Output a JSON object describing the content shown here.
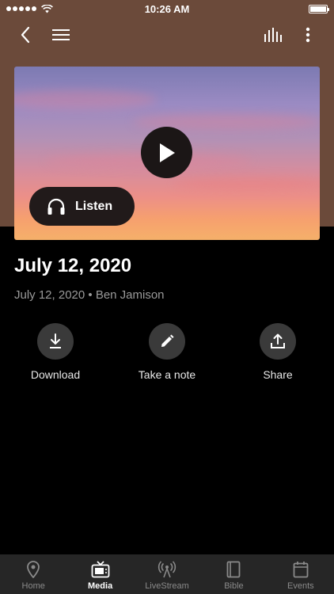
{
  "status": {
    "time": "10:26 AM"
  },
  "nav": {
    "back_icon": "chevron-left-icon",
    "menu_icon": "hamburger-menu-icon",
    "equalizer_icon": "equalizer-icon",
    "more_icon": "more-vertical-icon"
  },
  "media": {
    "listen_label": "Listen",
    "title": "July 12, 2020",
    "subtitle": "July 12, 2020 • Ben Jamison"
  },
  "actions": [
    {
      "label": "Download",
      "icon": "download-icon"
    },
    {
      "label": "Take a note",
      "icon": "pencil-icon"
    },
    {
      "label": "Share",
      "icon": "share-icon"
    }
  ],
  "tabs": [
    {
      "label": "Home",
      "icon": "map-pin-icon",
      "active": false
    },
    {
      "label": "Media",
      "icon": "tv-icon",
      "active": true
    },
    {
      "label": "LiveStream",
      "icon": "broadcast-icon",
      "active": false
    },
    {
      "label": "Bible",
      "icon": "book-icon",
      "active": false
    },
    {
      "label": "Events",
      "icon": "calendar-icon",
      "active": false
    }
  ],
  "colors": {
    "header_brown": "#6b4a3a",
    "background": "#000000",
    "tab_bar": "#262626",
    "button_dark": "#211a1a"
  }
}
